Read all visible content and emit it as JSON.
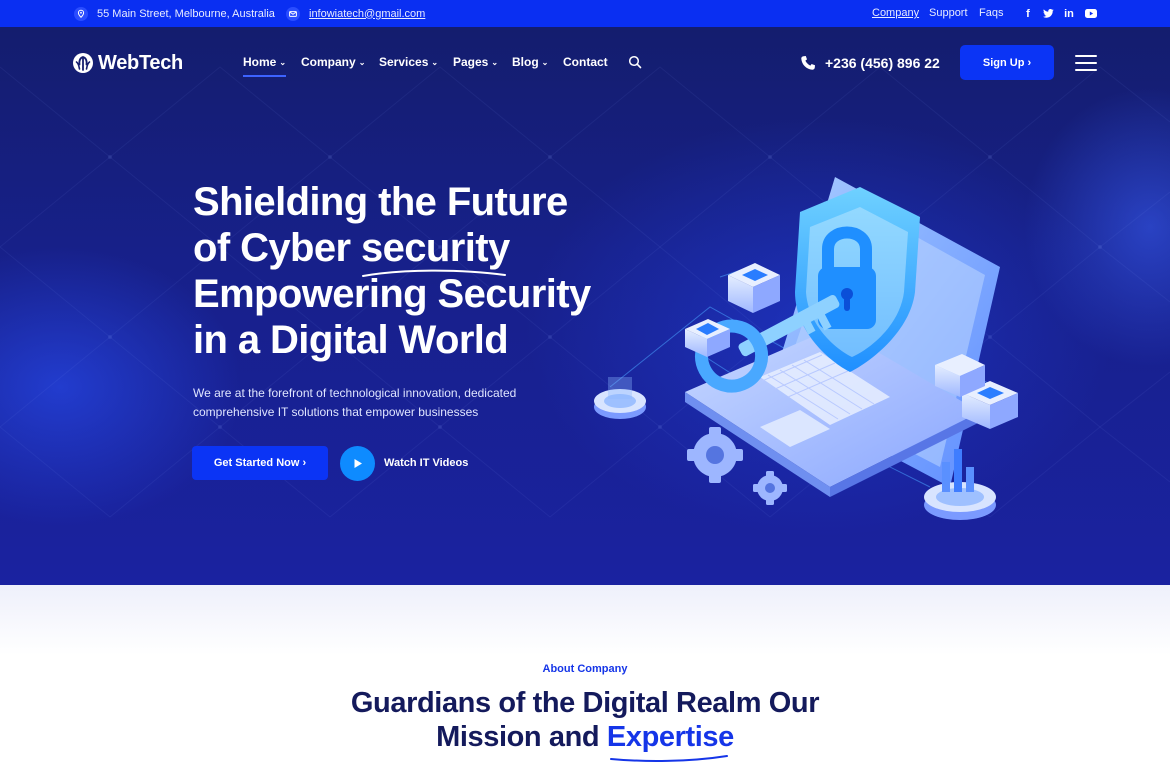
{
  "topbar": {
    "address": "55 Main Street, Melbourne, Australia",
    "email": "infowiatech@gmail.com",
    "links": [
      "Company",
      "Support",
      "Faqs"
    ],
    "social": [
      {
        "icon": "facebook-icon",
        "glyph": "f"
      },
      {
        "icon": "twitter-icon",
        "glyph": "t"
      },
      {
        "icon": "linkedin-icon",
        "glyph": "in"
      },
      {
        "icon": "youtube-icon",
        "glyph": "▶"
      }
    ]
  },
  "nav": {
    "logo": "WebTech",
    "items": [
      "Home",
      "Company",
      "Services",
      "Pages",
      "Blog",
      "Contact"
    ],
    "chevron": "⌄",
    "phone": "+236 (456) 896 22",
    "signup": "Sign Up ›"
  },
  "hero": {
    "title_lines": [
      "Shielding the Future",
      "of Cyber ",
      "security",
      "Empowering Security",
      "in a Digital World"
    ],
    "description_lines": [
      "We are at the forefront of technological innovation, dedicated",
      "comprehensive IT solutions that empower businesses"
    ],
    "primary_button": "Get Started Now ›",
    "video_label": "Watch IT Videos"
  },
  "about": {
    "label": "About Company",
    "title_line1": "Guardians of the Digital Realm Our",
    "title_line2_pre": "Mission and ",
    "title_line2_accent": "Expertise"
  },
  "colors": {
    "primary": "#0b34f5",
    "topbar": "#0a2ff2",
    "hero_dark": "#141d6e",
    "heading_dark": "#141a5c"
  }
}
